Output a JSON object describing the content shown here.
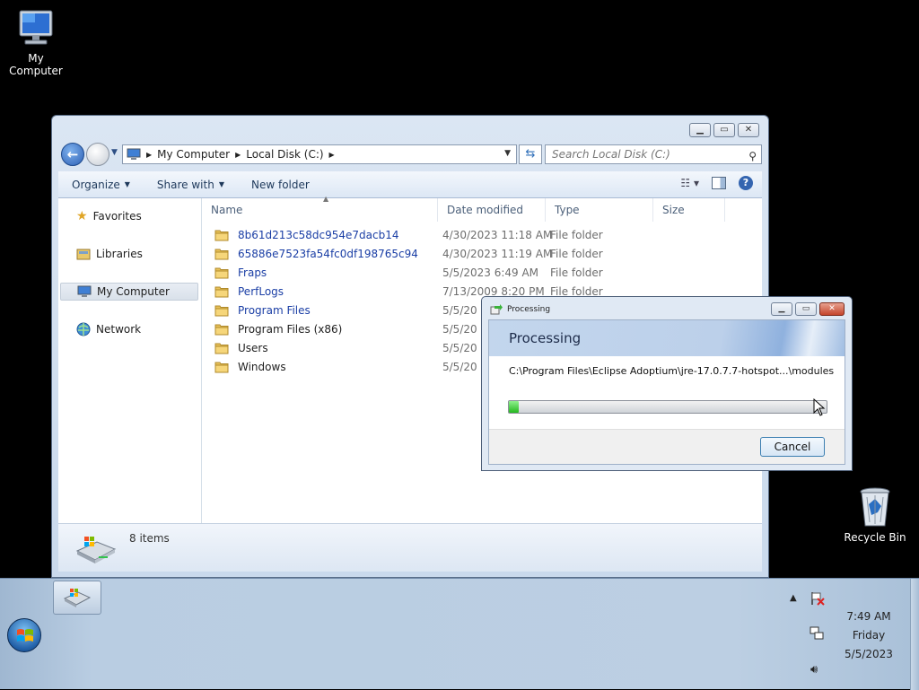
{
  "desktop": {
    "icons": [
      {
        "label": "My Computer",
        "icon": "computer-icon"
      },
      {
        "label": "Recycle Bin",
        "icon": "recycle-bin-icon"
      }
    ]
  },
  "explorer": {
    "address": {
      "crumbs": [
        "My Computer",
        "Local Disk (C:)"
      ]
    },
    "search_placeholder": "Search Local Disk (C:)",
    "toolbar": {
      "organize": "Organize",
      "share_with": "Share with",
      "new_folder": "New folder"
    },
    "nav": {
      "favorites": "Favorites",
      "libraries": "Libraries",
      "my_computer": "My Computer",
      "network": "Network"
    },
    "columns": {
      "name": "Name",
      "date_modified": "Date modified",
      "type": "Type",
      "size": "Size"
    },
    "rows": [
      {
        "name": "8b61d213c58dc954e7dacb14",
        "date": "4/30/2023 11:18 AM",
        "type": "File folder",
        "link": true
      },
      {
        "name": "65886e7523fa54fc0df198765c94",
        "date": "4/30/2023 11:19 AM",
        "type": "File folder",
        "link": true
      },
      {
        "name": "Fraps",
        "date": "5/5/2023 6:49 AM",
        "type": "File folder",
        "link": true
      },
      {
        "name": "PerfLogs",
        "date": "7/13/2009 8:20 PM",
        "type": "File folder",
        "link": true
      },
      {
        "name": "Program Files",
        "date": "5/5/20",
        "type": "",
        "link": true
      },
      {
        "name": "Program Files (x86)",
        "date": "5/5/20",
        "type": "",
        "link": false
      },
      {
        "name": "Users",
        "date": "5/5/20",
        "type": "",
        "link": false
      },
      {
        "name": "Windows",
        "date": "5/5/20",
        "type": "",
        "link": false
      }
    ],
    "status": {
      "items_count": "8 items"
    }
  },
  "dialog": {
    "title": "Processing",
    "heading": "Processing",
    "path": "C:\\Program Files\\Eclipse Adoptium\\jre-17.0.7.7-hotspot...\\modules",
    "progress_percent": 3,
    "cancel_label": "Cancel"
  },
  "taskbar": {
    "clock": {
      "time": "7:49 AM",
      "day": "Friday",
      "date": "5/5/2023"
    }
  },
  "colors": {
    "link_blue": "#1a3ea5",
    "progress_green": "#25b81f"
  }
}
